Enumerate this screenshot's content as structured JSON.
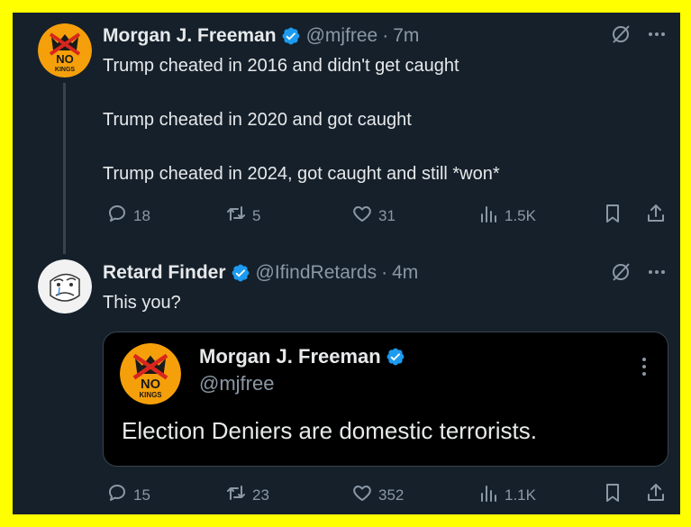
{
  "tweets": [
    {
      "author": {
        "name": "Morgan J. Freeman",
        "handle": "@mjfree",
        "avatar_text": "NO KINGS",
        "verified": true
      },
      "time": "7m",
      "text": "Trump cheated in 2016 and didn't get caught\n\nTrump cheated in 2020 and got caught\n\nTrump cheated in 2024, got caught and still *won*",
      "stats": {
        "replies": "18",
        "reposts": "5",
        "likes": "31",
        "views": "1.5K"
      }
    },
    {
      "author": {
        "name": "Retard Finder",
        "handle": "@IfindRetards",
        "verified": true
      },
      "time": "4m",
      "text": "This you?",
      "quote": {
        "author": {
          "name": "Morgan J. Freeman",
          "handle": "@mjfree",
          "avatar_text": "NO KINGS",
          "verified": true
        },
        "text": "Election Deniers are domestic terrorists."
      },
      "stats": {
        "replies": "15",
        "reposts": "23",
        "likes": "352",
        "views": "1.1K"
      }
    }
  ],
  "separator": "·",
  "icons": [
    "verified-badge-icon",
    "grok-icon",
    "more-icon",
    "reply-icon",
    "repost-icon",
    "like-icon",
    "views-icon",
    "bookmark-icon",
    "share-icon"
  ],
  "colors": {
    "frame_border": "#ffff00",
    "background": "#15202b",
    "accent": "#1d9bf0",
    "text": "#e7e9ea",
    "muted": "#8b98a5",
    "quote_background": "#000000"
  }
}
